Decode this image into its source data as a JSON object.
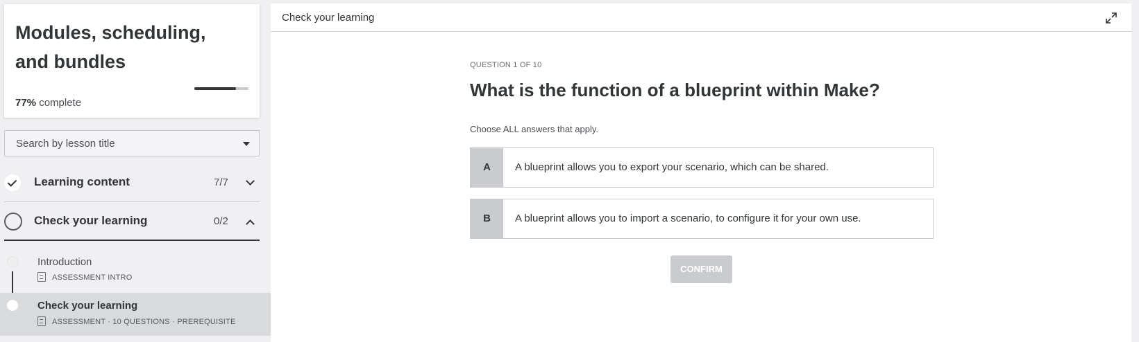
{
  "course": {
    "title": "Modules, scheduling, and bundles",
    "progress_percent": "77%",
    "progress_suffix": "complete",
    "progress_value": 0.77
  },
  "search": {
    "label": "Search by lesson title"
  },
  "sections": [
    {
      "title": "Learning content",
      "count": "7/7",
      "state": "complete",
      "expanded": false
    },
    {
      "title": "Check your learning",
      "count": "0/2",
      "state": "incomplete",
      "expanded": true
    }
  ],
  "lessons": [
    {
      "name": "Introduction",
      "meta": "ASSESSMENT INTRO",
      "active": false
    },
    {
      "name": "Check your learning",
      "meta": "ASSESSMENT · 10 QUESTIONS · PREREQUISITE",
      "active": true
    }
  ],
  "main": {
    "header_title": "Check your learning",
    "question_counter": "QUESTION 1 OF 10",
    "question": "What is the function of a blueprint within Make?",
    "instructions": "Choose ALL answers that apply.",
    "answers": [
      {
        "letter": "A",
        "text": "A blueprint allows you to export your scenario, which can be shared."
      },
      {
        "letter": "B",
        "text": "A blueprint allows you to import a scenario, to configure it for your own use."
      }
    ],
    "confirm_label": "CONFIRM"
  },
  "colors": {
    "text": "#313537",
    "muted": "#c9cbcf",
    "background": "#f0f0f2"
  }
}
